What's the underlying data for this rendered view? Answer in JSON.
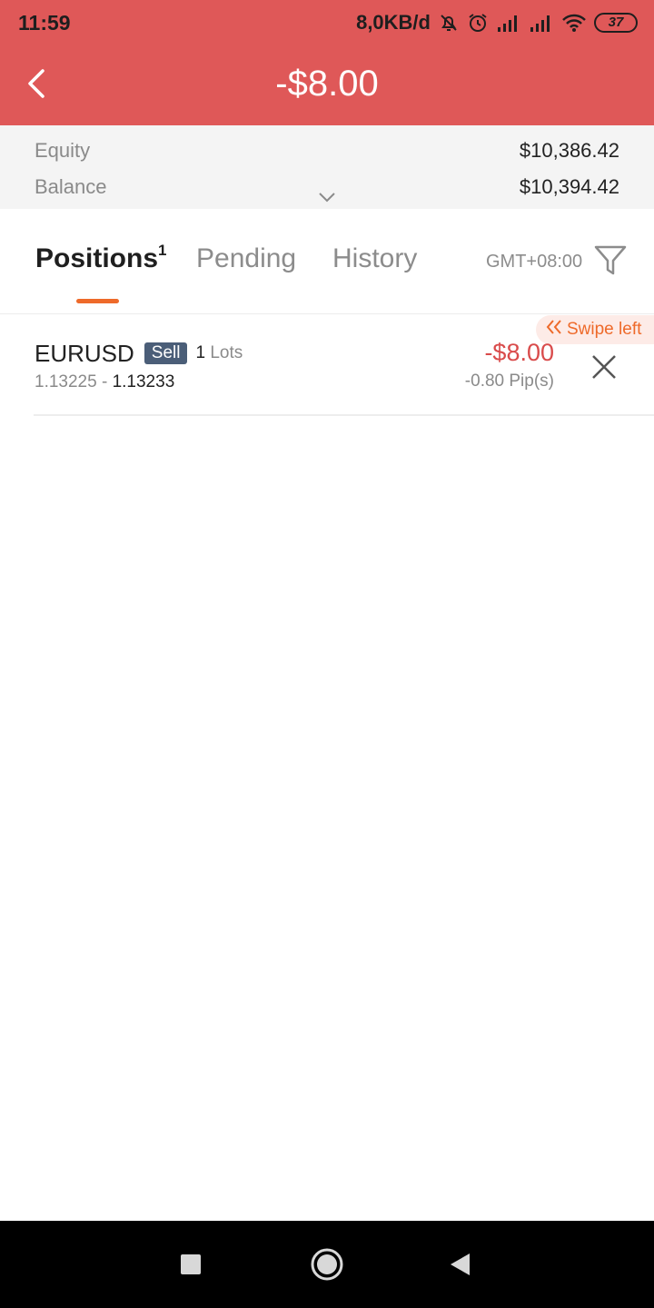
{
  "status_bar": {
    "time": "11:59",
    "network_speed": "8,0KB/d",
    "battery": "37",
    "icons": [
      "mute-bell-icon",
      "alarm-icon",
      "signal-icon",
      "signal-icon",
      "wifi-icon",
      "battery-icon"
    ]
  },
  "header": {
    "back_icon": "chevron-left-icon",
    "title": "-$8.00",
    "background_color": "#df5858"
  },
  "summary": {
    "equity_label": "Equity",
    "equity_value": "$10,386.42",
    "balance_label": "Balance",
    "balance_value": "$10,394.42",
    "expand_icon": "chevron-down-icon"
  },
  "tabs": {
    "positions_label": "Positions",
    "positions_count": "1",
    "pending_label": "Pending",
    "history_label": "History",
    "timezone": "GMT+08:00",
    "filter_icon": "filter-icon",
    "accent_color": "#ee6a2a"
  },
  "positions": [
    {
      "symbol": "EURUSD",
      "side": "Sell",
      "lots_count": "1",
      "lots_unit": "Lots",
      "open_price": "1.13225",
      "separator": "-",
      "current_price": "1.13233",
      "profit": "-$8.00",
      "pips": "-0.80 Pip(s)",
      "close_icon": "close-icon",
      "swipe_hint": "Swipe left",
      "loss_color": "#d94b4b"
    }
  ],
  "nav_bar": {
    "icons": [
      "recent-apps-icon",
      "home-icon",
      "back-icon"
    ]
  }
}
